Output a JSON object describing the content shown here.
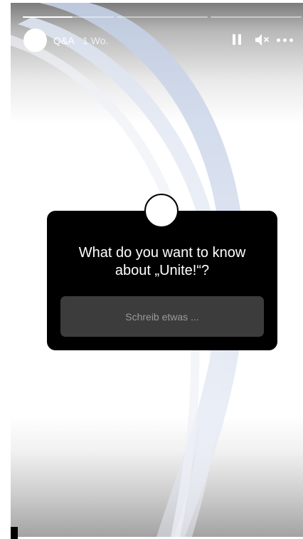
{
  "story": {
    "progress": [
      {
        "fraction": 0.55
      },
      {
        "fraction": 0
      },
      {
        "fraction": 0
      }
    ],
    "header": {
      "username": "Q&A",
      "time": "1 Wo.",
      "icons": [
        "pause-icon",
        "mute-icon",
        "more-icon"
      ]
    },
    "question_sticker": {
      "question": "What do you want to know about „Unite!“?",
      "input_placeholder": "Schreib etwas ..."
    }
  }
}
